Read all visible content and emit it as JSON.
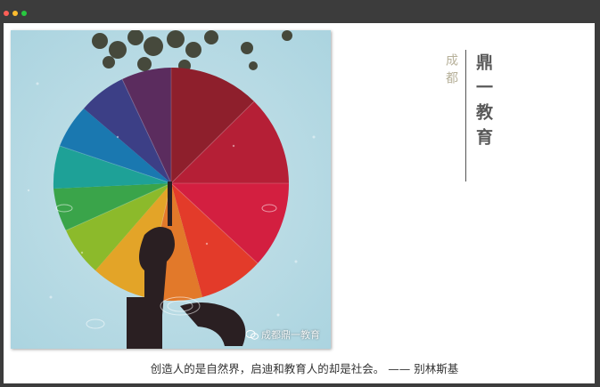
{
  "window": {
    "controls": [
      "close",
      "minimize",
      "maximize"
    ]
  },
  "header": {
    "small_vertical": "成都",
    "big_vertical": "鼎一教育"
  },
  "photo": {
    "subject_icon": "umbrella-reflection-photo",
    "watermark": "成都鼎一教育"
  },
  "quote": {
    "text": "创造人的是自然界，启迪和教育人的却是社会。 —— 别林斯基"
  },
  "colors": {
    "frame": "#3c3c3c",
    "page": "#ffffff",
    "accent_gray": "#595959",
    "muted_gold": "#b7b19a"
  }
}
